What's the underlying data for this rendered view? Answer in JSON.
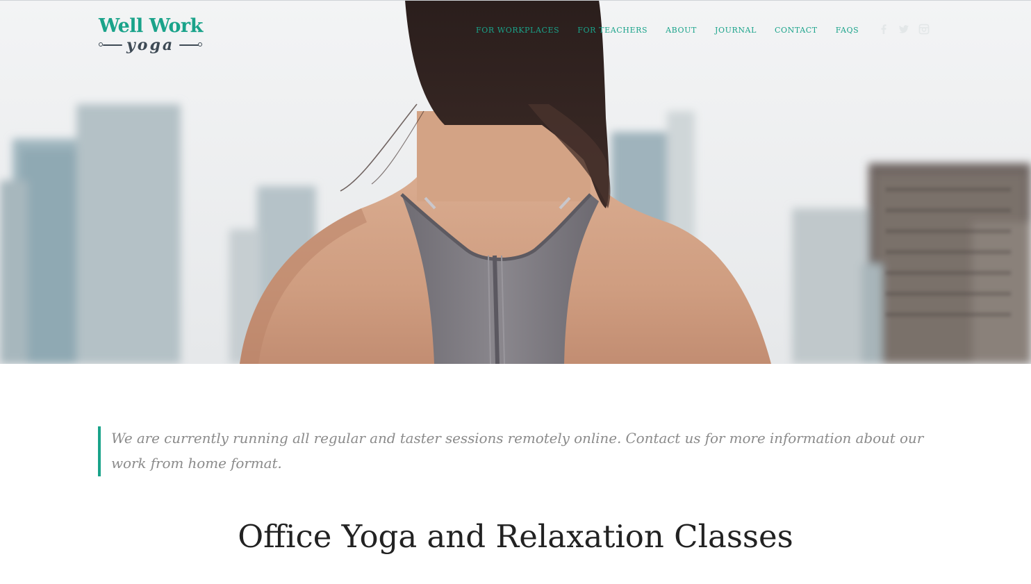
{
  "brand": {
    "line1": "Well Work",
    "line2": "yoga",
    "accent_color": "#1aa38a"
  },
  "nav": {
    "items": [
      {
        "label": "FOR WORKPLACES"
      },
      {
        "label": "FOR TEACHERS"
      },
      {
        "label": "ABOUT"
      },
      {
        "label": "JOURNAL"
      },
      {
        "label": "CONTACT"
      },
      {
        "label": "FAQS"
      }
    ]
  },
  "social": {
    "icons": [
      "facebook-icon",
      "twitter-icon",
      "instagram-icon"
    ]
  },
  "hero": {
    "image": "woman-back-city-skyline"
  },
  "notice": {
    "text": "We are currently running all regular and taster sessions remotely online. Contact us for more information about our work from home format."
  },
  "main": {
    "title": "Office Yoga and Relaxation Classes"
  }
}
